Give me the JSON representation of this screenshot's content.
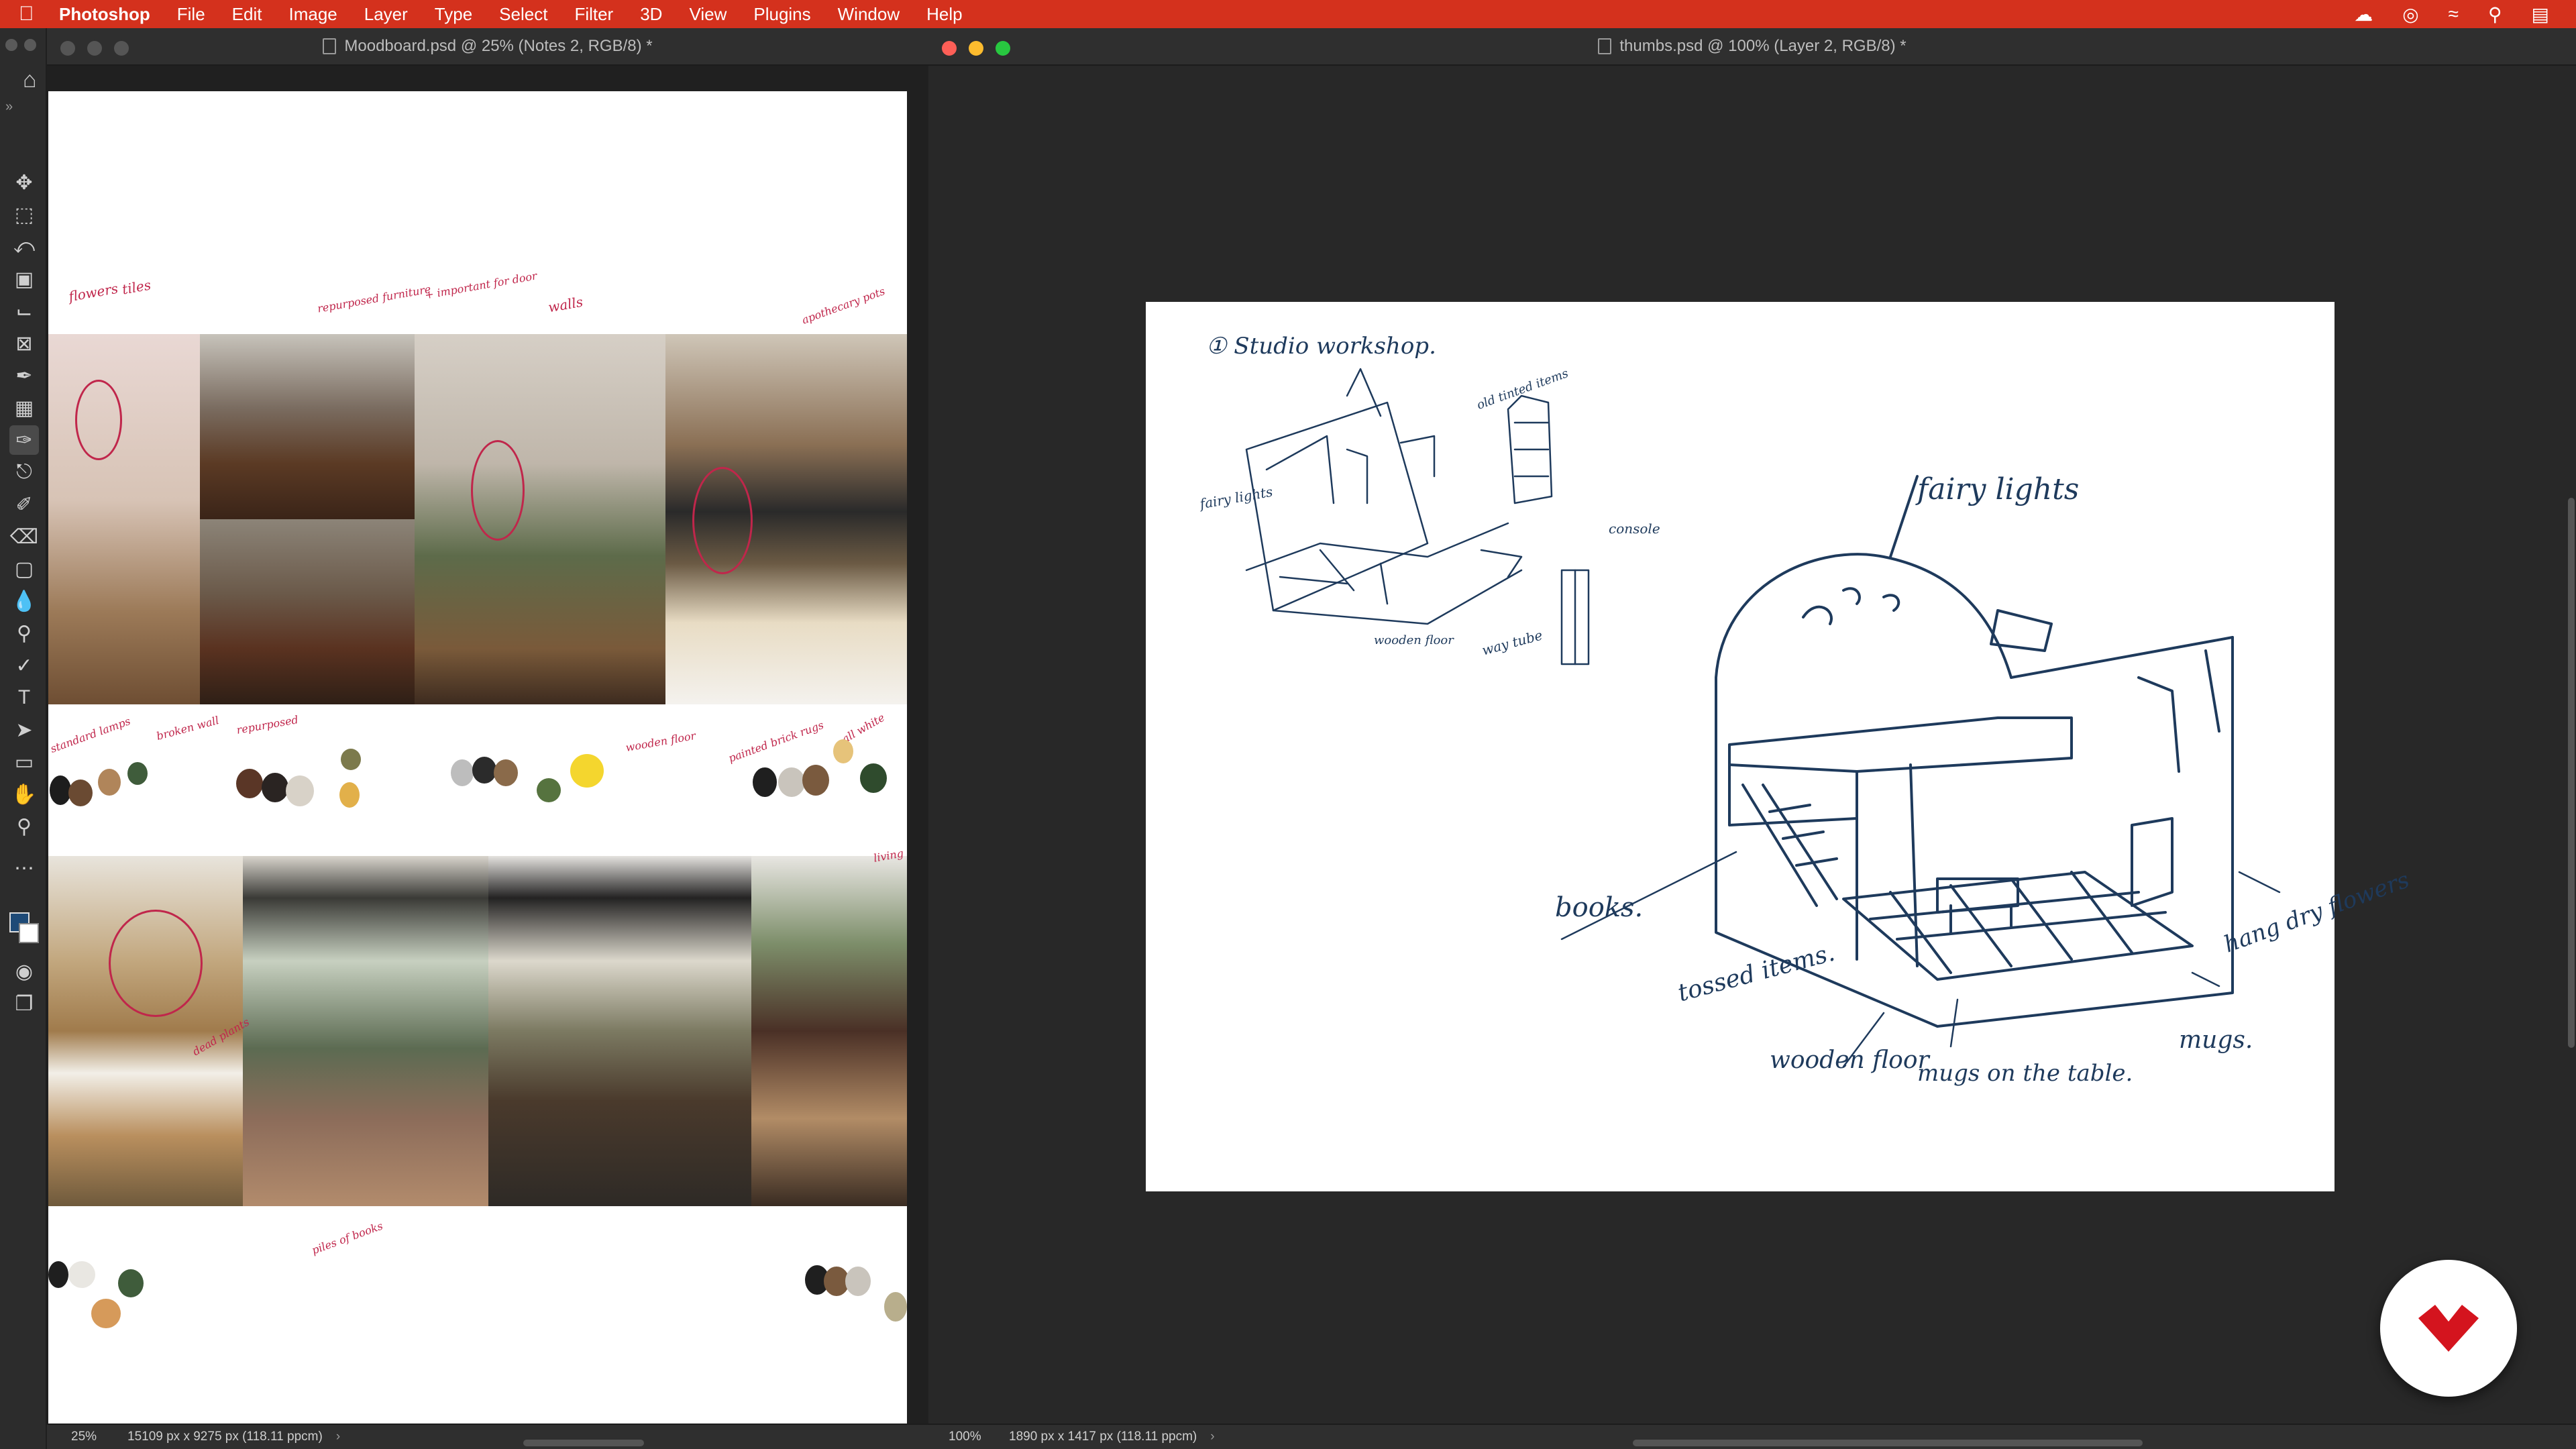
{
  "menubar": {
    "app": "Photoshop",
    "items": [
      "File",
      "Edit",
      "Image",
      "Layer",
      "Type",
      "Select",
      "Filter",
      "3D",
      "View",
      "Plugins",
      "Window",
      "Help"
    ]
  },
  "left_document": {
    "title": "Moodboard.psd @ 25% (Notes 2, RGB/8) *",
    "zoom": "25%",
    "dimensions": "15109 px x 9275 px (118.11 ppcm)",
    "annotations": {
      "a1": "flowers",
      "a2": "tiles",
      "a3": "repurposed furniture",
      "a4": "+ important for door",
      "a5": "walls",
      "a6": "apothecary pots",
      "a7": "standard lamps",
      "a8": "broken wall",
      "a9": "repurposed",
      "a10": "wooden floor",
      "a11": "painted brick rugs",
      "a12": "all white",
      "a13": "dead plants",
      "a14": "piles of books",
      "a15": "living"
    },
    "palette_colors": [
      "#1d1d1d",
      "#6a4a32",
      "#b0855a",
      "#3f5c3b",
      "#5a3626",
      "#2a2422",
      "#d8d2c8",
      "#7c7a4c",
      "#e2b04a",
      "#bdbdbd",
      "#2b2b2b",
      "#8a6a4a",
      "#56733f",
      "#f4d62e",
      "#e6c37a",
      "#1f1f1f",
      "#c9c4bc",
      "#7a5a3e",
      "#2f4b2d",
      "#e9e7e2",
      "#d69a5a",
      "#b8ae8c"
    ]
  },
  "right_document": {
    "title": "thumbs.psd @ 100% (Layer 2, RGB/8) *",
    "zoom": "100%",
    "dimensions": "1890 px x 1417 px (118.11 ppcm)",
    "sketch_labels": {
      "s1": "① Studio workshop.",
      "s2": "fairy lights",
      "s3": "old tinted items",
      "s4": "console",
      "s5": "fairy lights",
      "s6": "wooden floor",
      "s7": "way tube",
      "s8": "books.",
      "s9": "tossed items.",
      "s10": "wooden floor",
      "s11": "mugs on the table.",
      "s12": "hang dry flowers",
      "s13": "mugs."
    }
  },
  "colors": {
    "menubar": "#d4311d",
    "annotation": "#c0264b",
    "sketch_ink": "#1e3a5c",
    "badge_accent": "#d4141e"
  },
  "icons": [
    "apple-icon",
    "creative-cloud-icon",
    "wifi-icon",
    "search-icon",
    "control-center-icon",
    "home-icon",
    "move-tool-icon",
    "marquee-tool-icon",
    "lasso-tool-icon",
    "object-select-icon",
    "crop-tool-icon",
    "frame-tool-icon",
    "eyedropper-icon",
    "healing-brush-icon",
    "brush-tool-icon",
    "clone-stamp-icon",
    "history-brush-icon",
    "eraser-icon",
    "gradient-tool-icon",
    "blur-tool-icon",
    "dodge-tool-icon",
    "pen-tool-icon",
    "type-tool-icon",
    "path-select-icon",
    "rectangle-tool-icon",
    "hand-tool-icon",
    "zoom-tool-icon",
    "more-tools-icon"
  ]
}
